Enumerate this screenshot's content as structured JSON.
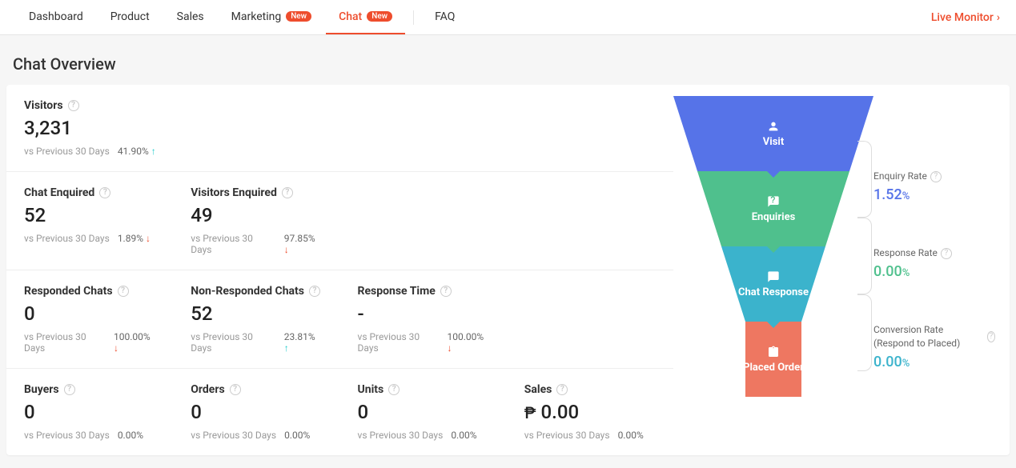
{
  "nav": {
    "items": [
      {
        "label": "Dashboard"
      },
      {
        "label": "Product"
      },
      {
        "label": "Sales"
      },
      {
        "label": "Marketing",
        "badge": "New"
      },
      {
        "label": "Chat",
        "badge": "New",
        "active": true
      },
      {
        "label": "FAQ"
      }
    ],
    "live_monitor": "Live Monitor"
  },
  "page_title": "Chat Overview",
  "compare_label": "vs Previous 30 Days",
  "metrics": {
    "visitors": {
      "label": "Visitors",
      "value": "3,231",
      "delta": "41.90%",
      "dir": "up"
    },
    "chat_enquired": {
      "label": "Chat Enquired",
      "value": "52",
      "delta": "1.89%",
      "dir": "down"
    },
    "visitors_enquired": {
      "label": "Visitors Enquired",
      "value": "49",
      "delta": "97.85%",
      "dir": "down"
    },
    "responded": {
      "label": "Responded Chats",
      "value": "0",
      "delta": "100.00%",
      "dir": "down"
    },
    "nonresponded": {
      "label": "Non-Responded Chats",
      "value": "52",
      "delta": "23.81%",
      "dir": "up"
    },
    "response_time": {
      "label": "Response Time",
      "value": "-",
      "delta": "100.00%",
      "dir": "down"
    },
    "buyers": {
      "label": "Buyers",
      "value": "0",
      "delta": "0.00%",
      "dir": "none"
    },
    "orders": {
      "label": "Orders",
      "value": "0",
      "delta": "0.00%",
      "dir": "none"
    },
    "units": {
      "label": "Units",
      "value": "0",
      "delta": "0.00%",
      "dir": "none"
    },
    "sales": {
      "label": "Sales",
      "currency": "₱",
      "value": "0.00",
      "delta": "0.00%",
      "dir": "none"
    }
  },
  "funnel": {
    "steps": [
      {
        "label": "Visit"
      },
      {
        "label": "Enquiries"
      },
      {
        "label": "Chat Response"
      },
      {
        "label": "Placed Order"
      }
    ],
    "rates": [
      {
        "label": "Enquiry Rate",
        "value": "1.52",
        "pct": "%"
      },
      {
        "label": "Response Rate",
        "value": "0.00",
        "pct": "%"
      },
      {
        "label": "Conversion Rate (Respond to Placed)",
        "value": "0.00",
        "pct": "%"
      }
    ]
  }
}
